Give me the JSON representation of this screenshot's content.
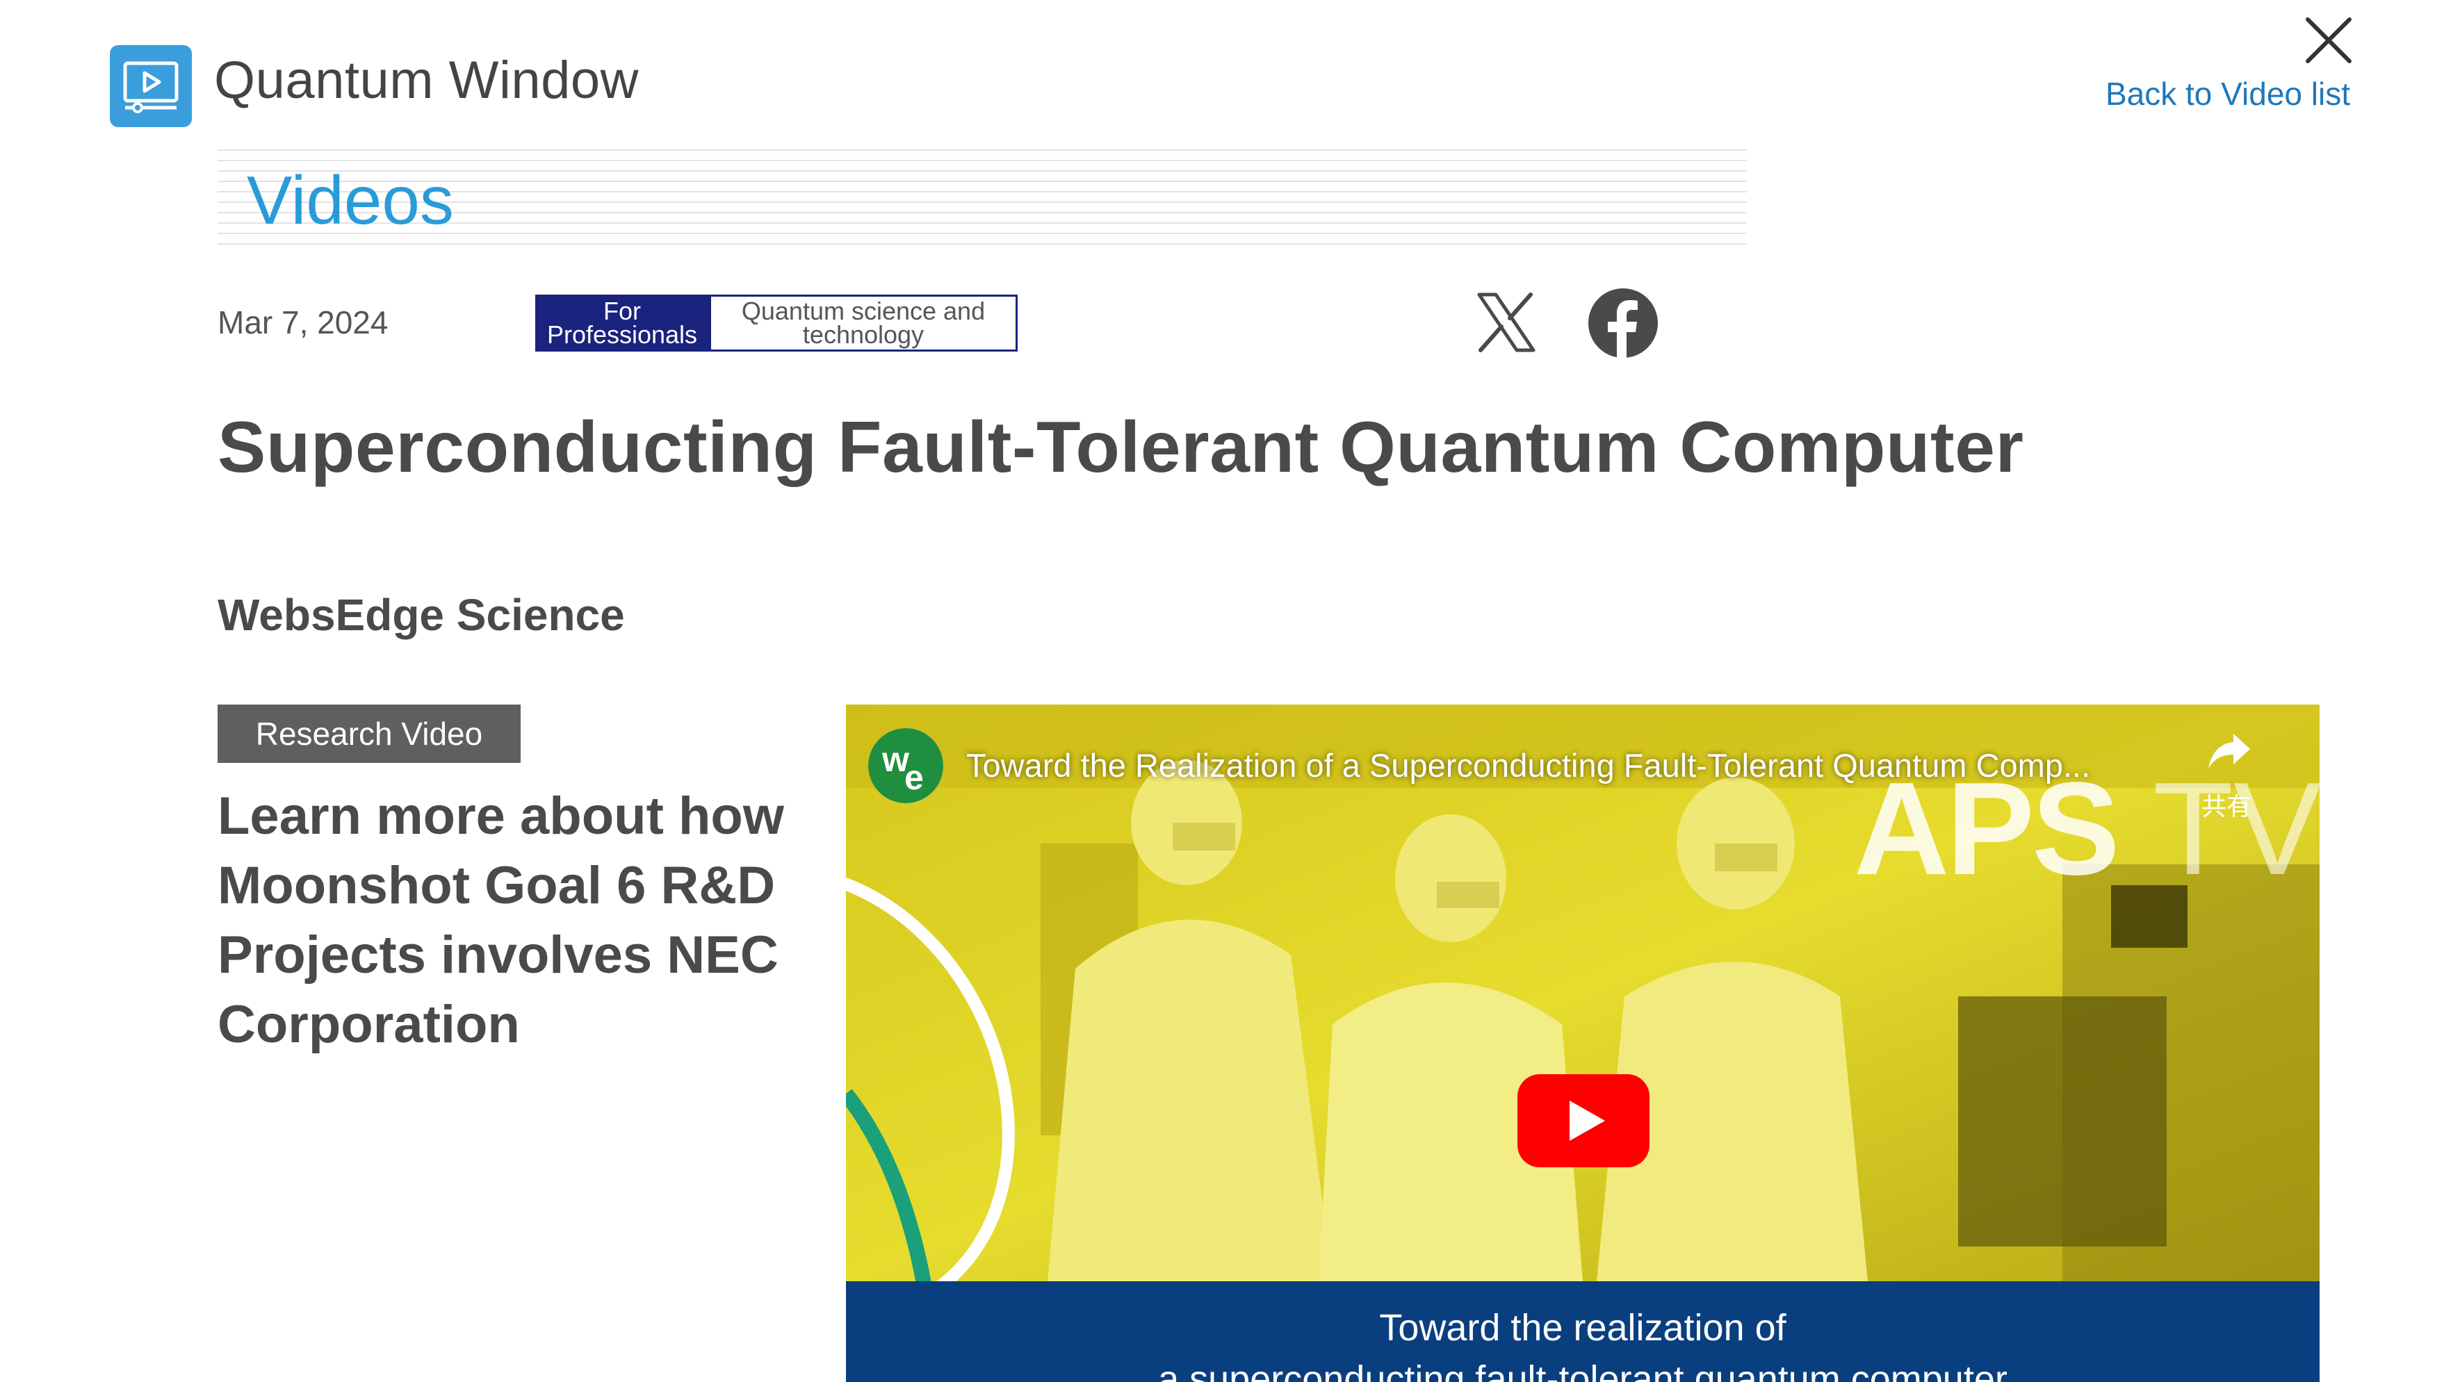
{
  "header": {
    "site_title": "Quantum Window",
    "back_link": "Back to Video list"
  },
  "section": {
    "title": "Videos"
  },
  "meta": {
    "date": "Mar 7, 2024",
    "tags": [
      "For Professionals",
      "Quantum science and technology"
    ]
  },
  "article": {
    "title": "Superconducting Fault-Tolerant Quantum Computer",
    "author": "WebsEdge Science",
    "badge": "Research Video",
    "description": "Learn more about how Moonshot Goal 6 R&D Projects involves NEC Corporation"
  },
  "video": {
    "title": "Toward the Realization of a Superconducting Fault-Tolerant Quantum Comp...",
    "share_label": "共有",
    "watermark": "APS",
    "watermark_suffix": "TV",
    "caption_line1": "Toward the realization of",
    "caption_line2": "a superconducting fault-tolerant quantum computer",
    "channel_logo_text": "we"
  },
  "icons": {
    "logo": "video-player-icon",
    "close": "close-icon",
    "x": "x-logo-icon",
    "facebook": "facebook-icon",
    "play": "youtube-play-icon",
    "share": "share-arrow-icon"
  },
  "colors": {
    "brand_blue": "#3a9ddc",
    "link_blue": "#1f78b8",
    "section_blue": "#2a9bd9",
    "tag_navy": "#1a237e",
    "badge_gray": "#5f5f5f",
    "youtube_red": "#ff0000",
    "caption_band": "#0a3f7f"
  }
}
